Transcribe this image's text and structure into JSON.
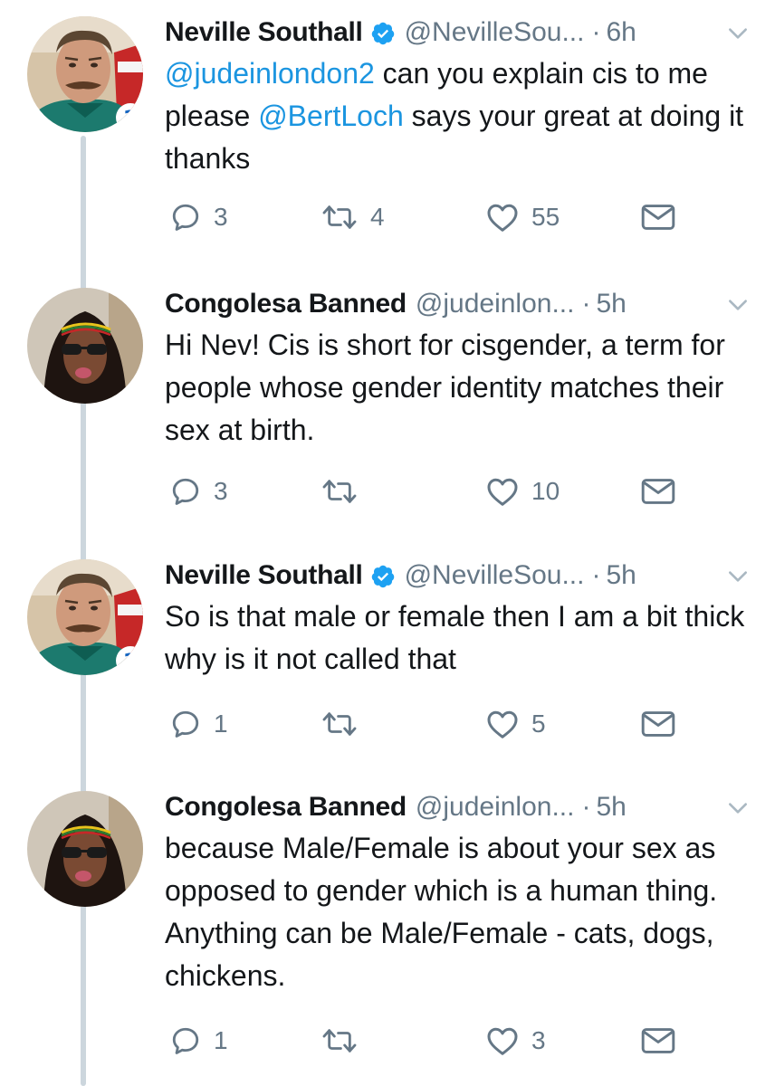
{
  "tweets": [
    {
      "name": "Neville Southall",
      "verified": true,
      "handle": "@NevilleSou...",
      "time": "6h",
      "text_parts": [
        {
          "t": "@judeinlondon2",
          "mention": true
        },
        {
          "t": " can you explain cis to me please ",
          "mention": false
        },
        {
          "t": "@BertLoch",
          "mention": true
        },
        {
          "t": " says your great at doing it thanks",
          "mention": false
        }
      ],
      "replies": "3",
      "retweets": "4",
      "likes": "55",
      "avatar": "neville"
    },
    {
      "name": "Congolesa Banned",
      "verified": false,
      "handle": "@judeinlon...",
      "time": "5h",
      "text_parts": [
        {
          "t": "Hi Nev! Cis is short for cisgender, a term for people whose gender identity matches their sex at birth.",
          "mention": false
        }
      ],
      "replies": "3",
      "retweets": "",
      "likes": "10",
      "avatar": "congolesa"
    },
    {
      "name": "Neville Southall",
      "verified": true,
      "handle": "@NevilleSou...",
      "time": "5h",
      "text_parts": [
        {
          "t": "So is that male or female then I am a bit thick  why is it not called that",
          "mention": false
        }
      ],
      "replies": "1",
      "retweets": "",
      "likes": "5",
      "avatar": "neville"
    },
    {
      "name": "Congolesa Banned",
      "verified": false,
      "handle": "@judeinlon...",
      "time": "5h",
      "text_parts": [
        {
          "t": "because Male/Female is about your sex as opposed to gender which is a human thing. Anything can be Male/Female - cats, dogs, chickens.",
          "mention": false
        }
      ],
      "replies": "1",
      "retweets": "",
      "likes": "3",
      "avatar": "congolesa"
    }
  ],
  "separator": "·",
  "icons": {
    "reply": "reply-icon",
    "retweet": "retweet-icon",
    "like": "heart-icon",
    "dm": "envelope-icon",
    "verified": "verified-badge-icon",
    "caret": "chevron-down-icon"
  },
  "colors": {
    "name": "#14171a",
    "meta": "#657786",
    "mention": "#1b95e0",
    "verified": "#1da1f2",
    "thread_line": "#ccd6dd"
  }
}
